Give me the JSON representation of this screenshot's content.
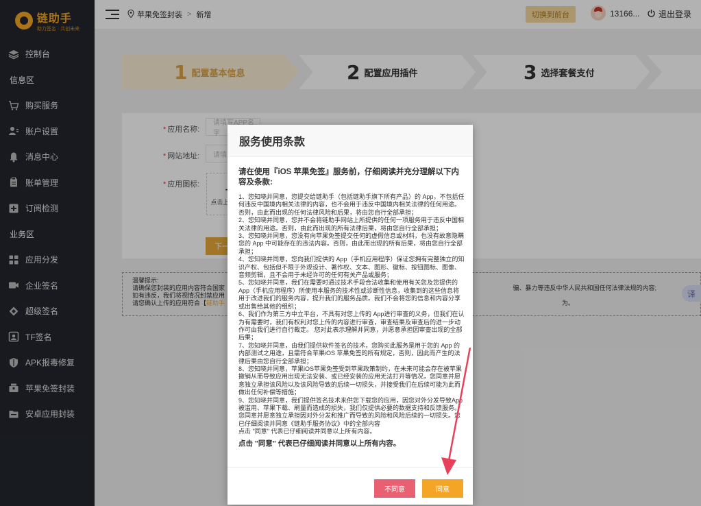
{
  "logo": {
    "name": "链助手",
    "sub": "助力签名 · 共创未来",
    "accent": "#f5a623"
  },
  "sidebar": {
    "items": [
      {
        "label": "控制台",
        "icon": "layers-icon"
      },
      {
        "label": "信息区",
        "section": true
      },
      {
        "label": "购买服务",
        "icon": "cart-icon"
      },
      {
        "label": "账户设置",
        "icon": "user-settings-icon"
      },
      {
        "label": "消息中心",
        "icon": "bell-icon"
      },
      {
        "label": "账单管理",
        "icon": "clipboard-icon"
      },
      {
        "label": "订阅检测",
        "icon": "plus-square-icon"
      },
      {
        "label": "业务区",
        "section": true
      },
      {
        "label": "应用分发",
        "icon": "grid-icon"
      },
      {
        "label": "企业签名",
        "icon": "video-icon"
      },
      {
        "label": "超级签名",
        "icon": "diamond-icon"
      },
      {
        "label": "TF签名",
        "icon": "tf-icon"
      },
      {
        "label": "APK报毒修复",
        "icon": "shield-icon"
      },
      {
        "label": "苹果免签封装",
        "icon": "package-icon"
      },
      {
        "label": "安卓应用封装",
        "icon": "folder-icon"
      }
    ]
  },
  "header": {
    "breadcrumb": [
      "苹果免签封装",
      "新增"
    ],
    "switch_label": "切换到前台",
    "user": "13166...",
    "logout": "退出登录"
  },
  "steps": [
    {
      "num": "1",
      "label": "配置基本信息"
    },
    {
      "num": "2",
      "label": "配置应用插件"
    },
    {
      "num": "3",
      "label": "选择套餐支付"
    }
  ],
  "form": {
    "name_label": "应用名称:",
    "name_placeholder": "请填写APP名字",
    "site_label": "网站地址:",
    "site_placeholder": "请填写http://或",
    "icon_label": "应用图标:",
    "upload_label": "点击上传图标",
    "next_label": "下一步"
  },
  "tips": {
    "title": "温馨提示:",
    "line1": "请确保您封装的应用内容符合国家",
    "line1_end": "骗、暴力等违反中华人民共和国任何法律法规的内容;",
    "line2": "如有违反，我们将视情况封禁应用",
    "line3": "请您确认上传的应用符合【",
    "line3_hl": "链助手",
    "line3_end": "为。"
  },
  "translate_label": "译",
  "modal": {
    "title": "服务使用条款",
    "intro": "请在使用『iOS 苹果免签』服务前，仔细阅读并充分理解以下内容及条款:",
    "paragraphs": [
      "1、您知晓并同意，您提交给链助手（包括链助手旗下所有产品）的 App，不包括任何违反中国境内相关法律的内容，也不会用于违反中国境内相关法律的任何用途。否则，由此而出现的任何法律风险和后果，将由您自行全部承担；",
      "2、您知晓并同意，您并不会将链助手网站上所提供的任何一项服务用于违反中国相关法律的用途。否则，由此而出现的所有法律后果，将由您自行全部承担；",
      "3、您知晓并同意，您没有向苹果免签提交任何的虚假信息或材料，也没有故意隐瞒您的 App 中可能存在的违法内容。否则，由此而出现的所有后果，将由您自行全部承担；",
      "4、您知晓并同意，您向我们提供的 App（手机应用程序）保证您拥有完整独立的知识产权、包括但不限于外观设计、著作权、文本、图形、徽标、按钮图标、图像、音频剪辑，且不会用于未经许可的任何有关产品或服务；",
      "5、您知晓并同意，我们在需要时通过技术手段合法收集和使用有关您及您提供的App（手机应用程序）所使用本服务的技术性或诊断性信息，收集到的这些信息将用于改进我们的服务内容，提升我们的服务品质。我们不会将您的信息和内容分享或出售给其他的组织；",
      "6、我们作为第三方中立平台，不具有对您上传的 App进行审查的义务，但我们在认为有需要时，我们有权利对您上传的内容进行审查，审查结果及审查后的进一步动作可由我们进行自行裁定。 您对此表示理解并同意，并愿意承担因审查出现的全部后果；",
      "7、您知晓并同意，由我们提供软件签名的技术，您购买此服务是用于您的 App 的内部测试之用途，且需符合苹果iOS 苹果免签的所有规定，否则，因此而产生的法律后果由您自行全部承担；",
      "8、您知晓并同意，苹果iOS苹果免签受到苹果政策制约，在未来可能会存在被苹果撤销从而导致应用出现无法安装、或已经安装的应用无法打开等情况，您同意并愿意独立承担该风险以及该风险导致的后续一切损失，并接受我们在后续可能为此而做出任何补偿等措施；",
      "9、您知晓并同意，我们提供签名技术来供您下载您的应用，因您对外分发导致App被滥用、苹果下载、刷量而造成的损失，我们仅提供必要的数据支持和反馈服务。 您同意并愿意独立承担因对外分发和推广而导致的风险和风险后续的一切损失。您已仔细阅读并同意《链助手服务协议》中的全部内容",
      "点击 \"同意\" 代表已仔细阅读并同意以上所有内容。"
    ],
    "outro": "点击 \"同意\" 代表已仔细阅读并同意以上所有内容。",
    "disagree_label": "不同意",
    "agree_label": "同意"
  },
  "colors": {
    "arrow": "#e8405a",
    "agree": "#f4a526",
    "disagree": "#e96072"
  }
}
